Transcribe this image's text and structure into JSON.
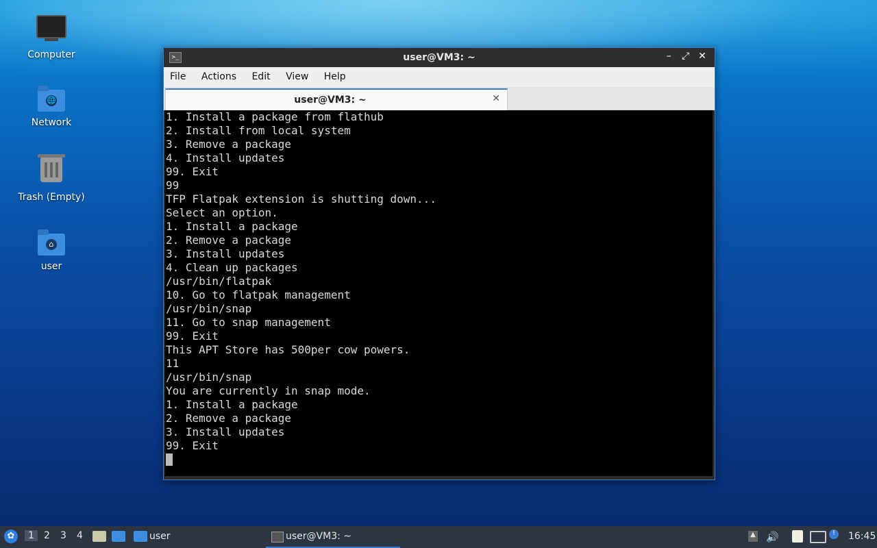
{
  "desktop": {
    "icons": [
      {
        "label": "Computer"
      },
      {
        "label": "Network"
      },
      {
        "label": "Trash (Empty)"
      },
      {
        "label": "user"
      }
    ]
  },
  "window": {
    "title": "user@VM3: ~",
    "menu": [
      "File",
      "Actions",
      "Edit",
      "View",
      "Help"
    ],
    "tab_label": "user@VM3: ~",
    "terminal_lines": [
      "1. Install a package from flathub",
      "2. Install from local system",
      "3. Remove a package",
      "4. Install updates",
      "99. Exit",
      "99",
      "TFP Flatpak extension is shutting down...",
      "Select an option.",
      "1. Install a package",
      "2. Remove a package",
      "3. Install updates",
      "4. Clean up packages",
      "/usr/bin/flatpak",
      "10. Go to flatpak management",
      "/usr/bin/snap",
      "11. Go to snap management",
      "99. Exit",
      "This APT Store has 500per cow powers.",
      "11",
      "/usr/bin/snap",
      "You are currently in snap mode.",
      "1. Install a package",
      "2. Remove a package",
      "3. Install updates",
      "99. Exit"
    ]
  },
  "taskbar": {
    "workspaces": [
      "1",
      "2",
      "3",
      "4"
    ],
    "folder_label": "user",
    "task_label": "user@VM3: ~",
    "clock": "16:45"
  }
}
